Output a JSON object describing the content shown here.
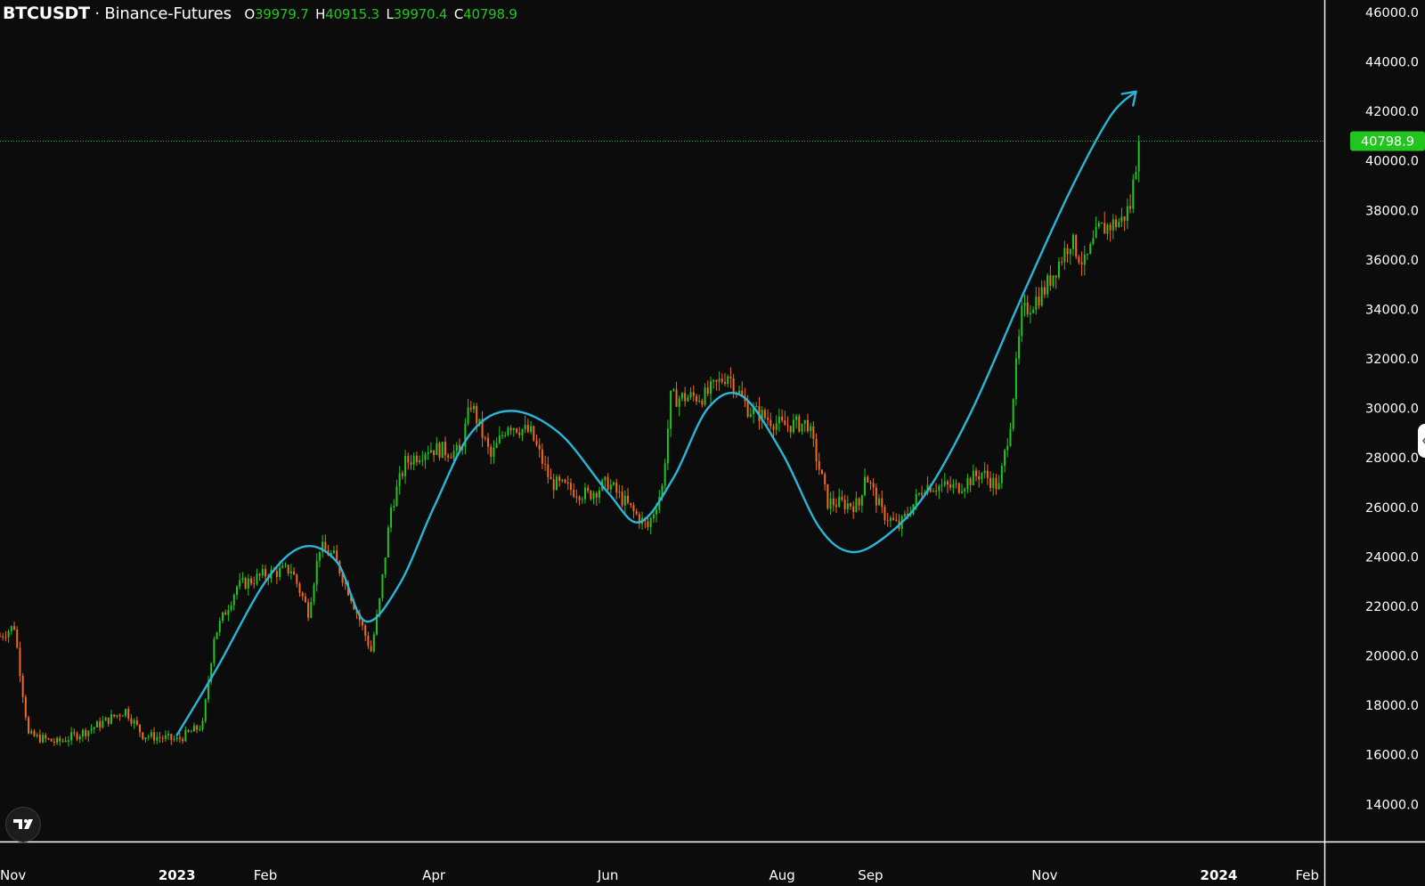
{
  "header": {
    "symbol": "BTCUSDT",
    "separator": " · ",
    "exchange": "Binance-Futures",
    "open_key": "O",
    "open": "39979.7",
    "high_key": "H",
    "high": "40915.3",
    "low_key": "L",
    "low": "39970.4",
    "close_key": "C",
    "close": "40798.9"
  },
  "last_price_label": "40798.9",
  "colors": {
    "background": "#0c0c0c",
    "up": "#22c51d",
    "down": "#f26a1b",
    "curve": "#29b6d8",
    "axis_text": "#ffffff",
    "price_badge": "#22c51d"
  },
  "icons": {
    "logo": "tradingview-logo-icon",
    "handle": "chevron-left-icon"
  },
  "chart_data": {
    "type": "candlestick",
    "symbol": "BTCUSDT",
    "exchange": "Binance-Futures",
    "ylim": [
      12500,
      46500
    ],
    "x_range": [
      "2022-10-31",
      "2024-02-07"
    ],
    "y_ticks": [
      "46000.0",
      "44000.0",
      "42000.0",
      "40000.0",
      "38000.0",
      "36000.0",
      "34000.0",
      "32000.0",
      "30000.0",
      "28000.0",
      "26000.0",
      "24000.0",
      "22000.0",
      "20000.0",
      "18000.0",
      "16000.0",
      "14000.0"
    ],
    "x_ticks": [
      {
        "date": "2022-11-01",
        "label": "Nov",
        "bold": false
      },
      {
        "date": "2023-01-01",
        "label": "2023",
        "bold": true
      },
      {
        "date": "2023-02-01",
        "label": "Feb",
        "bold": false
      },
      {
        "date": "2023-04-01",
        "label": "Apr",
        "bold": false
      },
      {
        "date": "2023-06-01",
        "label": "Jun",
        "bold": false
      },
      {
        "date": "2023-08-01",
        "label": "Aug",
        "bold": false
      },
      {
        "date": "2023-09-01",
        "label": "Sep",
        "bold": false
      },
      {
        "date": "2023-11-01",
        "label": "Nov",
        "bold": false
      },
      {
        "date": "2024-01-01",
        "label": "2024",
        "bold": true
      },
      {
        "date": "2024-02-01",
        "label": "Feb",
        "bold": false
      }
    ],
    "last_price": 40798.9,
    "price_path": [
      [
        "2022-10-31",
        20800
      ],
      [
        "2022-11-05",
        21200
      ],
      [
        "2022-11-08",
        18500
      ],
      [
        "2022-11-10",
        16800
      ],
      [
        "2022-11-20",
        16500
      ],
      [
        "2022-12-01",
        17000
      ],
      [
        "2022-12-14",
        17800
      ],
      [
        "2022-12-20",
        16800
      ],
      [
        "2023-01-01",
        16600
      ],
      [
        "2023-01-10",
        17200
      ],
      [
        "2023-01-14",
        20800
      ],
      [
        "2023-01-22",
        22800
      ],
      [
        "2023-02-01",
        23300
      ],
      [
        "2023-02-10",
        23500
      ],
      [
        "2023-02-16",
        21800
      ],
      [
        "2023-02-20",
        24400
      ],
      [
        "2023-02-25",
        24000
      ],
      [
        "2023-03-03",
        22400
      ],
      [
        "2023-03-10",
        20200
      ],
      [
        "2023-03-13",
        22200
      ],
      [
        "2023-03-17",
        26000
      ],
      [
        "2023-03-22",
        27800
      ],
      [
        "2023-03-30",
        28400
      ],
      [
        "2023-04-10",
        28200
      ],
      [
        "2023-04-14",
        30200
      ],
      [
        "2023-04-21",
        28000
      ],
      [
        "2023-04-27",
        29400
      ],
      [
        "2023-05-05",
        29000
      ],
      [
        "2023-05-12",
        27000
      ],
      [
        "2023-05-25",
        26500
      ],
      [
        "2023-06-01",
        27000
      ],
      [
        "2023-06-10",
        25800
      ],
      [
        "2023-06-15",
        25200
      ],
      [
        "2023-06-20",
        26800
      ],
      [
        "2023-06-23",
        30400
      ],
      [
        "2023-07-05",
        30500
      ],
      [
        "2023-07-13",
        31400
      ],
      [
        "2023-07-20",
        30000
      ],
      [
        "2023-08-01",
        29300
      ],
      [
        "2023-08-10",
        29400
      ],
      [
        "2023-08-17",
        26200
      ],
      [
        "2023-08-28",
        26100
      ],
      [
        "2023-08-30",
        27400
      ],
      [
        "2023-09-05",
        25800
      ],
      [
        "2023-09-11",
        25200
      ],
      [
        "2023-09-20",
        26900
      ],
      [
        "2023-10-01",
        26800
      ],
      [
        "2023-10-10",
        27400
      ],
      [
        "2023-10-16",
        26800
      ],
      [
        "2023-10-20",
        29500
      ],
      [
        "2023-10-24",
        33800
      ],
      [
        "2023-11-01",
        34800
      ],
      [
        "2023-11-10",
        36800
      ],
      [
        "2023-11-15",
        35800
      ],
      [
        "2023-11-20",
        37200
      ],
      [
        "2023-11-28",
        37600
      ],
      [
        "2023-12-01",
        38200
      ],
      [
        "2023-12-04",
        40798.9
      ]
    ],
    "trend_curve": [
      [
        "2023-01-01",
        16800
      ],
      [
        "2023-01-15",
        19500
      ],
      [
        "2023-02-01",
        23000
      ],
      [
        "2023-02-14",
        24400
      ],
      [
        "2023-02-26",
        23800
      ],
      [
        "2023-03-08",
        21400
      ],
      [
        "2023-03-20",
        22900
      ],
      [
        "2023-04-01",
        26000
      ],
      [
        "2023-04-14",
        29000
      ],
      [
        "2023-04-28",
        29900
      ],
      [
        "2023-05-15",
        29000
      ],
      [
        "2023-06-01",
        26600
      ],
      [
        "2023-06-12",
        25400
      ],
      [
        "2023-06-24",
        27200
      ],
      [
        "2023-07-06",
        30000
      ],
      [
        "2023-07-18",
        30500
      ],
      [
        "2023-08-01",
        28200
      ],
      [
        "2023-08-14",
        25200
      ],
      [
        "2023-08-25",
        24200
      ],
      [
        "2023-09-06",
        24800
      ],
      [
        "2023-09-20",
        26500
      ],
      [
        "2023-10-06",
        29800
      ],
      [
        "2023-10-24",
        34500
      ],
      [
        "2023-11-10",
        38800
      ],
      [
        "2023-11-24",
        41800
      ],
      [
        "2023-12-03",
        42800
      ]
    ]
  }
}
